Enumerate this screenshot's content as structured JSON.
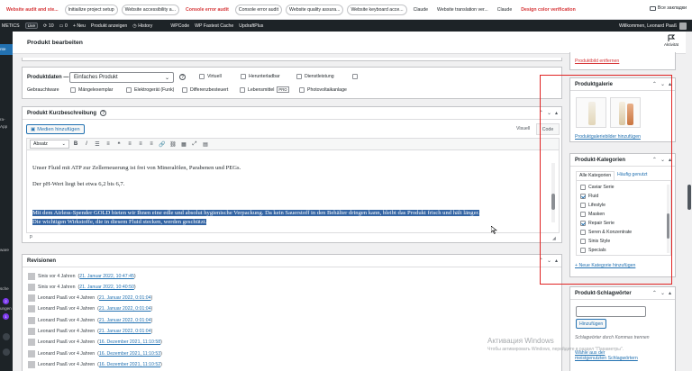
{
  "bookmarks": [
    {
      "label": "Website audit and ste...",
      "style": "red"
    },
    {
      "label": "Initiailize project setup",
      "style": "tag"
    },
    {
      "label": "Website accessibility a...",
      "style": "tag"
    },
    {
      "label": "Console error audit",
      "style": "red"
    },
    {
      "label": "Console error audit",
      "style": "tag"
    },
    {
      "label": "Website quality assura...",
      "style": "tag"
    },
    {
      "label": "Website keyboard acce...",
      "style": "tag"
    },
    {
      "label": "Claude",
      "style": "plain"
    },
    {
      "label": "Website translation ver...",
      "style": "plain"
    },
    {
      "label": "Claude",
      "style": "plain"
    },
    {
      "label": "Design color verification",
      "style": "red"
    }
  ],
  "all_bookmarks": "Все закладки",
  "adminbar": {
    "site": "METICS",
    "live": "Live",
    "updates": "10",
    "comments": "0",
    "new": "+ Neu",
    "view_product": "Produkt anzeigen",
    "history": "History",
    "wpcode": "WPCode",
    "cache": "WP Fastest Cache",
    "updraft": "UpdraftPlus",
    "greeting": "Willkommen, Leonard Paaß"
  },
  "adminmenu": {
    "items": [
      "nte",
      "ra-",
      "App",
      "ware",
      "sche",
      "ungen"
    ],
    "bubbles": [
      "2",
      "1"
    ]
  },
  "page": {
    "title": "Produkt bearbeiten",
    "activity": "Aktivität"
  },
  "product_data": {
    "label": "Produktdaten —",
    "type_value": "Einfaches Produkt",
    "help": "?",
    "options_row1": [
      "Virtuell",
      "Herunterladbar",
      "Dienstleistung"
    ],
    "options_row2": [
      "Gebrauchtware",
      "Mängelexemplar",
      "Elektrogerät (Funk)",
      "Differenzbesteuert",
      "Lebensmittel",
      "Photovoltaikanlage"
    ],
    "pro_badge": "PRO"
  },
  "short_desc": {
    "title": "Produkt Kurzbeschreibung",
    "media_button": "Medien hinzufügen",
    "tab_visual": "Visuell",
    "tab_code": "Code",
    "format_value": "Absatz",
    "p1": "Unser Fluid mit ATP zur Zellerneuerung ist frei von Mineralölen, Parabenen und PEGs.",
    "p2": "Der pH-Wert liegt bei etwa 6,2 bis 6,7.",
    "selected_line1": "Mit dem Airless-Spender GOLD bieten wir Ihnen eine edle und absolut hygienische Verpackung. Da kein Sauerstoff in den Behälter dringen kann, bleibt das Produkt frisch und hält länger.",
    "selected_line2": "Die wichtigen Wirkstoffe, die in diesem Fluid stecken, werden geschützt.",
    "path": "p"
  },
  "revisions": {
    "title": "Revisionen",
    "rows": [
      {
        "author": "Sinis vor 4 Jahren",
        "date": "21. Januar 2022, 10:47:45"
      },
      {
        "author": "Sinis vor 4 Jahren",
        "date": "21. Januar 2022, 10:40:50"
      },
      {
        "author": "Leonard Paaß vor 4 Jahren",
        "date": "21. Januar 2022, 0:01:04"
      },
      {
        "author": "Leonard Paaß vor 4 Jahren",
        "date": "21. Januar 2022, 0:01:04"
      },
      {
        "author": "Leonard Paaß vor 4 Jahren",
        "date": "21. Januar 2022, 0:01:04"
      },
      {
        "author": "Leonard Paaß vor 4 Jahren",
        "date": "21. Januar 2022, 0:01:04"
      },
      {
        "author": "Leonard Paaß vor 4 Jahren",
        "date": "16. Dezember 2021, 11:10:58"
      },
      {
        "author": "Leonard Paaß vor 4 Jahren",
        "date": "16. Dezember 2021, 11:10:53"
      },
      {
        "author": "Leonard Paaß vor 4 Jahren",
        "date": "16. Dezember 2021, 11:10:52"
      },
      {
        "author": "Leonard Paaß vor 4 Jahren",
        "date": "16. Dezember 2021, 11:10:52"
      }
    ]
  },
  "sidebar": {
    "remove_image": "Produktbild entfernen",
    "gallery_title": "Produktgalerie",
    "gallery_add": "Produktgaleriebilder hinzufügen",
    "categories_title": "Produkt-Kategorien",
    "tab_all": "Alle Kategorien",
    "tab_popular": "Häufig genutzt",
    "categories": [
      {
        "label": "Caviar Serie",
        "checked": false
      },
      {
        "label": "Fluid",
        "checked": true
      },
      {
        "label": "Lifestyle",
        "checked": false
      },
      {
        "label": "Masken",
        "checked": false
      },
      {
        "label": "Repair Serie",
        "checked": true
      },
      {
        "label": "Seren & Konzentrate",
        "checked": false
      },
      {
        "label": "Sinis Style",
        "checked": false
      },
      {
        "label": "Specials",
        "checked": false
      }
    ],
    "add_category": "+ Neue Kategorie hinzufügen",
    "tags_title": "Produkt-Schlagwörter",
    "tags_button": "Hinzufügen",
    "tags_hint": "Schlagwörter durch Kommas trennen",
    "tags_choose": "Wähle aus der",
    "tags_choose_link": "meistgenutzten Schlagwörtern"
  },
  "watermark": {
    "line1": "Активация Windows",
    "line2": "Чтобы активировать Windows, перейдите в раздел \"Параметры\"."
  }
}
